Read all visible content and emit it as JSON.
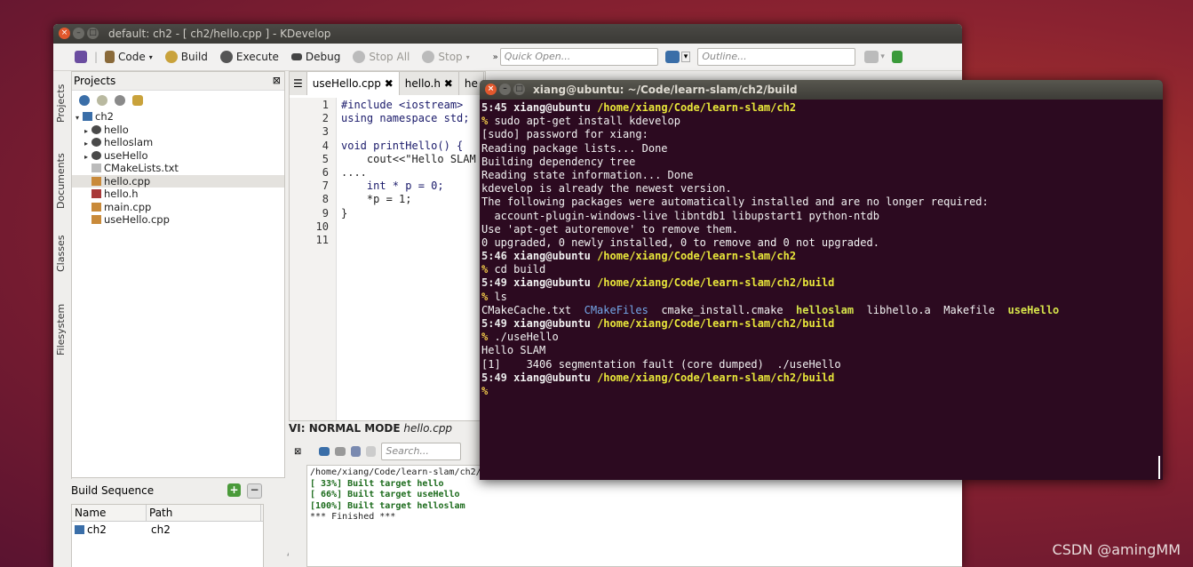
{
  "kdevelop": {
    "window_title": "default:  ch2 - [ ch2/hello.cpp ] - KDevelop",
    "toolbar": {
      "code": "Code",
      "build": "Build",
      "execute": "Execute",
      "debug": "Debug",
      "stop_all": "Stop All",
      "stop": "Stop",
      "quick_open_placeholder": "Quick Open...",
      "outline_placeholder": "Outline..."
    },
    "side_tabs": [
      "Projects",
      "Documents",
      "Classes",
      "Filesystem"
    ],
    "projects": {
      "title": "Projects",
      "tree": [
        {
          "label": "ch2",
          "level": 0,
          "icon": "project-icon"
        },
        {
          "label": "hello",
          "level": 1,
          "icon": "target-icon"
        },
        {
          "label": "helloslam",
          "level": 1,
          "icon": "target-icon"
        },
        {
          "label": "useHello",
          "level": 1,
          "icon": "target-icon"
        },
        {
          "label": "CMakeLists.txt",
          "level": 1,
          "icon": "text-file-icon"
        },
        {
          "label": "hello.cpp",
          "level": 1,
          "icon": "cpp-file-icon",
          "selected": true
        },
        {
          "label": "hello.h",
          "level": 1,
          "icon": "header-file-icon"
        },
        {
          "label": "main.cpp",
          "level": 1,
          "icon": "cpp-file-icon"
        },
        {
          "label": "useHello.cpp",
          "level": 1,
          "icon": "cpp-file-icon"
        }
      ]
    },
    "build_sequence": {
      "title": "Build Sequence",
      "columns": [
        "Name",
        "Path"
      ],
      "rows": [
        {
          "name": "ch2",
          "path": "ch2"
        }
      ]
    },
    "editor": {
      "tabs": [
        "useHello.cpp",
        "hello.h",
        "he"
      ],
      "lines": [
        {
          "n": "1",
          "text": "#include <iostream>"
        },
        {
          "n": "2",
          "text": "using namespace std;"
        },
        {
          "n": "3",
          "text": ""
        },
        {
          "n": "4",
          "text": "void printHello() {"
        },
        {
          "n": "5",
          "text": "    cout<<\"Hello SLAM"
        },
        {
          "n": "6",
          "text": "...."
        },
        {
          "n": "7",
          "text": "    int * p = 0;"
        },
        {
          "n": "8",
          "text": "    *p = 1;"
        },
        {
          "n": "9",
          "text": "}"
        },
        {
          "n": "10",
          "text": ""
        },
        {
          "n": "11",
          "text": ""
        }
      ]
    },
    "vi_mode": "VI: NORMAL MODE",
    "vi_file": "hello.cpp",
    "output": {
      "search_placeholder": "Search...",
      "lines": [
        "/home/xiang/Code/learn-slam/ch2/",
        "[ 33%] Built target hello",
        "[ 66%] Built target useHello",
        "[100%] Built target helloslam",
        "*** Finished ***"
      ]
    }
  },
  "terminal": {
    "title": "xiang@ubuntu: ~/Code/learn-slam/ch2/build",
    "lines": [
      {
        "kind": "prompt",
        "time": "5:45",
        "host": "xiang@ubuntu",
        "path": "/home/xiang/Code/learn-slam/ch2"
      },
      {
        "kind": "cmd",
        "text": "sudo apt-get install kdevelop"
      },
      {
        "kind": "out",
        "text": "[sudo] password for xiang:"
      },
      {
        "kind": "out",
        "text": "Reading package lists... Done"
      },
      {
        "kind": "out",
        "text": "Building dependency tree"
      },
      {
        "kind": "out",
        "text": "Reading state information... Done"
      },
      {
        "kind": "out",
        "text": "kdevelop is already the newest version."
      },
      {
        "kind": "out",
        "text": "The following packages were automatically installed and are no longer required:"
      },
      {
        "kind": "out",
        "text": "  account-plugin-windows-live libntdb1 libupstart1 python-ntdb"
      },
      {
        "kind": "out",
        "text": "Use 'apt-get autoremove' to remove them."
      },
      {
        "kind": "out",
        "text": "0 upgraded, 0 newly installed, 0 to remove and 0 not upgraded."
      },
      {
        "kind": "prompt",
        "time": "5:46",
        "host": "xiang@ubuntu",
        "path": "/home/xiang/Code/learn-slam/ch2"
      },
      {
        "kind": "cmd",
        "text": "cd build"
      },
      {
        "kind": "prompt",
        "time": "5:49",
        "host": "xiang@ubuntu",
        "path": "/home/xiang/Code/learn-slam/ch2/build"
      },
      {
        "kind": "cmd",
        "text": "ls"
      },
      {
        "kind": "ls"
      },
      {
        "kind": "prompt",
        "time": "5:49",
        "host": "xiang@ubuntu",
        "path": "/home/xiang/Code/learn-slam/ch2/build"
      },
      {
        "kind": "cmd",
        "text": "./useHello"
      },
      {
        "kind": "out",
        "text": "Hello SLAM"
      },
      {
        "kind": "out",
        "text": "[1]    3406 segmentation fault (core dumped)  ./useHello"
      },
      {
        "kind": "prompt",
        "time": "5:49",
        "host": "xiang@ubuntu",
        "path": "/home/xiang/Code/learn-slam/ch2/build"
      },
      {
        "kind": "cursor"
      }
    ],
    "ls_entries": [
      {
        "name": "CMakeCache.txt",
        "type": "file"
      },
      {
        "name": "CMakeFiles",
        "type": "dir"
      },
      {
        "name": "cmake_install.cmake",
        "type": "file"
      },
      {
        "name": "helloslam",
        "type": "exe"
      },
      {
        "name": "libhello.a",
        "type": "file"
      },
      {
        "name": "Makefile",
        "type": "file"
      },
      {
        "name": "useHello",
        "type": "exe"
      }
    ]
  },
  "watermark": "CSDN @amingMM"
}
